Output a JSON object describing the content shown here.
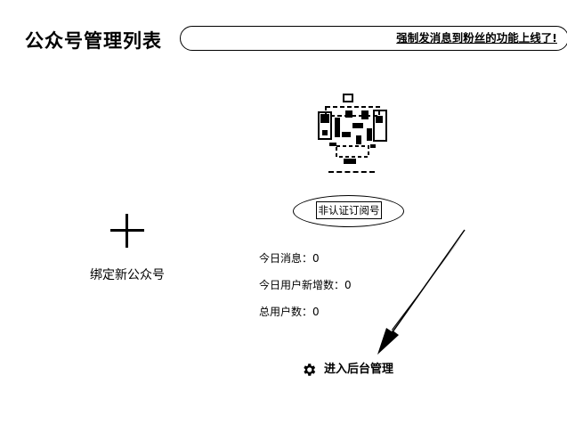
{
  "header": {
    "title": "公众号管理列表",
    "announcement": "强制发消息到粉丝的功能上线了!"
  },
  "bind_card": {
    "icon": "plus-icon",
    "label": "绑定新公众号"
  },
  "account": {
    "qr_icon": "qr-code-icon",
    "type_badge": "非认证订阅号",
    "stats": {
      "today_messages": "今日消息：0",
      "today_new_users": "今日用户新增数：0",
      "total_users": "总用户数：0"
    },
    "enter_label": "进入后台管理",
    "enter_icon": "gear-icon"
  },
  "colors": {
    "ink": "#000000",
    "background": "#ffffff"
  }
}
